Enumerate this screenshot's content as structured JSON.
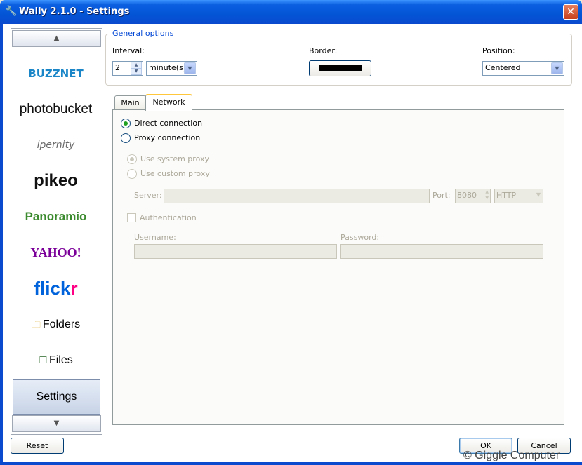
{
  "window": {
    "title": "Wally 2.1.0 - Settings",
    "title_icon": "wrench-icon",
    "close_symbol": "✕"
  },
  "sidebar": {
    "scroll_up": "▲",
    "scroll_down": "▼",
    "items": [
      {
        "label": "BUZZNET"
      },
      {
        "label": "photobucket"
      },
      {
        "label": "ipernity"
      },
      {
        "label": "pikeo"
      },
      {
        "label": "Panoramio"
      },
      {
        "label": "YAHOO!"
      },
      {
        "label": "flick",
        "label_accent": "r"
      },
      {
        "label": "Folders",
        "icon": "folder-icon"
      },
      {
        "label": "Files",
        "icon": "files-icon"
      },
      {
        "label": "Settings",
        "selected": true
      }
    ]
  },
  "general": {
    "legend": "General options",
    "interval_label": "Interval:",
    "interval_value": "2",
    "interval_unit": "minute(s)",
    "border_label": "Border:",
    "border_color": "#000000",
    "position_label": "Position:",
    "position_value": "Centered"
  },
  "tabs": [
    {
      "label": "Main"
    },
    {
      "label": "Network",
      "active": true
    }
  ],
  "network": {
    "direct_label": "Direct connection",
    "direct_checked": true,
    "proxy_label": "Proxy connection",
    "use_system_proxy": "Use system proxy",
    "use_custom_proxy": "Use custom proxy",
    "server_label": "Server:",
    "server_value": "",
    "port_label": "Port:",
    "port_value": "8080",
    "protocol_value": "HTTP",
    "auth_label": "Authentication",
    "username_label": "Username:",
    "password_label": "Password:"
  },
  "buttons": {
    "reset": "Reset",
    "ok": "OK",
    "cancel": "Cancel"
  },
  "watermark": "© Giggle Computer",
  "colors": {
    "titlebar": "#0455D6",
    "accent_tab": "#FFC83C",
    "radio_on": "#21A121",
    "legend": "#0046D5"
  }
}
